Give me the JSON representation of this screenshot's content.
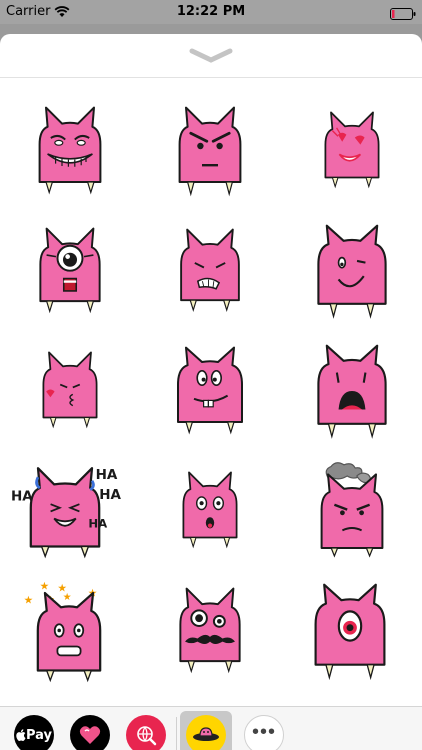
{
  "status_bar": {
    "carrier": "Carrier",
    "time": "12:22 PM",
    "wifi_icon": "wifi-icon",
    "battery_icon": "battery-icon"
  },
  "sheet": {
    "grabber_icon": "chevron-down-icon"
  },
  "stickers": [
    {
      "name": "grinning-monster",
      "text": ""
    },
    {
      "name": "angry-monster",
      "text": ""
    },
    {
      "name": "heart-eyes-monster",
      "text": ""
    },
    {
      "name": "cyclops-scared-monster",
      "text": ""
    },
    {
      "name": "grimace-monster",
      "text": ""
    },
    {
      "name": "winking-monster",
      "text": ""
    },
    {
      "name": "kissing-monster",
      "text": ""
    },
    {
      "name": "buck-tooth-monster",
      "text": ""
    },
    {
      "name": "shocked-monster",
      "text": ""
    },
    {
      "name": "laughing-monster",
      "text": "HA HA HA HA"
    },
    {
      "name": "surprised-monster",
      "text": ""
    },
    {
      "name": "fuming-monster",
      "text": ""
    },
    {
      "name": "dizzy-monster",
      "text": ""
    },
    {
      "name": "mustache-monster",
      "text": ""
    },
    {
      "name": "cyclops-monster",
      "text": ""
    }
  ],
  "laugh": {
    "ha1": "HA",
    "ha2": "HA",
    "ha3": "HA",
    "ha4": "HA"
  },
  "tray": {
    "apple_pay_label": "Pay",
    "apple_pay_icon": "apple-icon",
    "heart_app_icon": "heart-icon",
    "globe_app_icon": "globe-icon",
    "selected_app_icon": "ufo-icon",
    "more_label": "•••"
  },
  "colors": {
    "monster_pink": "#f06aaa",
    "outline": "#1a1a1a",
    "tooth": "#f4f0c0",
    "accent_red": "#e8254f",
    "selected_app": "#ffd500"
  }
}
